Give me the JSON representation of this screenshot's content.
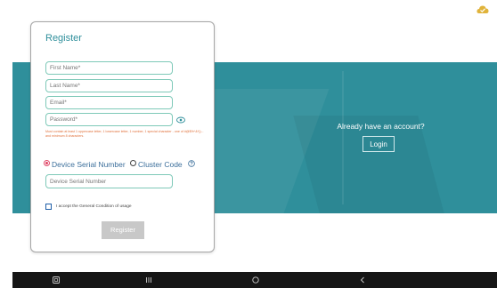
{
  "colors": {
    "accent": "#2f8f9b",
    "field_border": "#7ec9b8",
    "hint": "#e0703a",
    "radio_selected": "#e04a6a",
    "nav_bg": "#161616"
  },
  "top_icon": "cloud-check-icon",
  "card": {
    "title": "Register",
    "fields": {
      "first_name": {
        "placeholder": "First Name*",
        "value": ""
      },
      "last_name": {
        "placeholder": "Last Name*",
        "value": ""
      },
      "email": {
        "placeholder": "Email*",
        "value": ""
      },
      "password": {
        "placeholder": "Password*",
        "value": ""
      }
    },
    "password_icon": "eye-icon",
    "password_hint": "Must contain at least 1 uppercase letter, 1 lowercase letter, 1 number, 1 special character - one of #@$%^&*()... and minimum 8 characters.",
    "device_type": {
      "options": [
        "Device Serial Number",
        "Cluster Code"
      ],
      "selected": "Device Serial Number",
      "help_icon": "help-icon"
    },
    "serial_field": {
      "placeholder": "Device Serial Number",
      "value": ""
    },
    "accept_label": "I accept the General Condition of usage",
    "accept_checked": false,
    "register_label": "Register"
  },
  "banner": {
    "already_text": "Already have an account?",
    "login_label": "Login"
  },
  "navbar": {
    "items": [
      "screenshot-icon",
      "recent-apps-icon",
      "home-icon",
      "back-icon"
    ]
  }
}
